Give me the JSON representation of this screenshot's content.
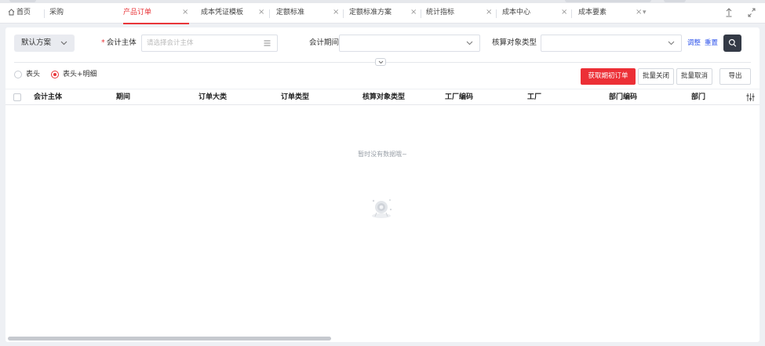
{
  "tabs": [
    {
      "label": "首页",
      "closable": false,
      "active": false
    },
    {
      "label": "采购",
      "closable": false,
      "active": false
    },
    {
      "label": "产品订单",
      "closable": true,
      "active": true
    },
    {
      "label": "成本凭证模板",
      "closable": true,
      "active": false
    },
    {
      "label": "定额标准",
      "closable": true,
      "active": false
    },
    {
      "label": "定额标准方案",
      "closable": true,
      "active": false
    },
    {
      "label": "统计指标",
      "closable": true,
      "active": false
    },
    {
      "label": "成本中心",
      "closable": true,
      "active": false
    },
    {
      "label": "成本要素",
      "closable": true,
      "active": false
    }
  ],
  "tab_close_glyph": "×",
  "tab_more_glyph": "▾",
  "filters": {
    "scheme": "默认方案",
    "entity_label": "会计主体",
    "entity_placeholder": "请选择会计主体",
    "period_label": "会计期间",
    "period_value": "",
    "object_type_label": "核算对象类型",
    "object_type_value": "",
    "adjust": "调整",
    "reset": "重置"
  },
  "view_mode": {
    "options": [
      "表头",
      "表头+明细"
    ],
    "selected": "表头+明细"
  },
  "actions": {
    "fetch": "获取期初订单",
    "batch_close": "批量关闭",
    "batch_cancel": "批量取消",
    "export": "导出"
  },
  "table": {
    "columns": [
      "会计主体",
      "期间",
      "订单大类",
      "订单类型",
      "核算对象类型",
      "工厂编码",
      "工厂",
      "部门编码",
      "部门"
    ],
    "rows": []
  },
  "empty_text": "暂时没有数据哦~",
  "colors": {
    "accent": "#e8363a",
    "primary_button": "#ec2f36",
    "link": "#2f54eb",
    "search_button": "#343a46"
  },
  "icons": {
    "home": "home-icon",
    "pin": "pin-icon",
    "expand": "expand-icon",
    "list": "list-icon",
    "chevron": "chevron-down-icon",
    "search": "search-icon",
    "collapse": "collapse-icon",
    "column_settings": "column-settings-icon",
    "empty": "empty-data-illustration"
  }
}
